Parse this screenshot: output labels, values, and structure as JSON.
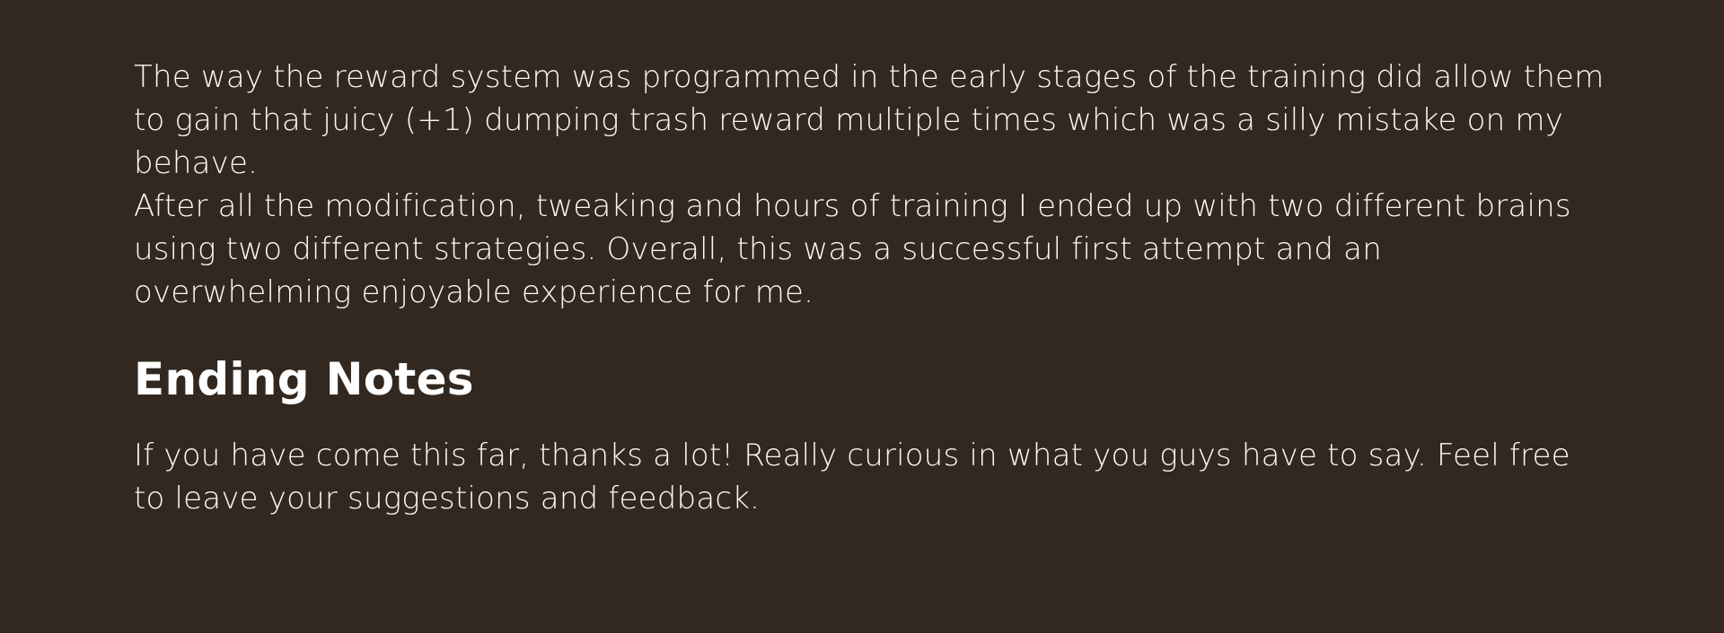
{
  "article": {
    "paragraph_1": "The way the reward system was programmed in the early stages of the training did allow them to gain that juicy (+1) dumping trash reward multiple times which was a silly mistake on my behave.",
    "paragraph_2": "After all the modification, tweaking and hours of training I ended up with two different brains using two different strategies. Overall, this was a successful first attempt and an overwhelming enjoyable experience for me.",
    "section_heading": "Ending Notes",
    "paragraph_3": "If you have come this far, thanks a lot! Really curious in what you guys have to say. Feel free to leave your suggestions and feedback."
  },
  "colors": {
    "background": "#322820",
    "text": "#fbf8f4"
  }
}
